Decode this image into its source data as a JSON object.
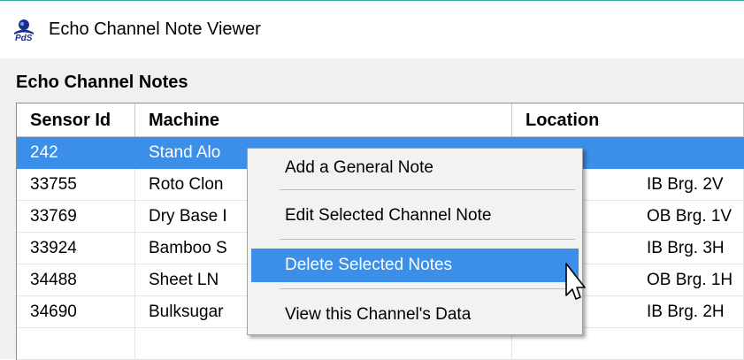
{
  "window": {
    "title": "Echo Channel Note Viewer"
  },
  "panel": {
    "title": "Echo Channel Notes"
  },
  "table": {
    "columns": [
      "Sensor Id",
      "Machine",
      "Location"
    ],
    "rows": [
      {
        "sensor_id": "242",
        "machine": "Stand Alo",
        "location": ""
      },
      {
        "sensor_id": "33755",
        "machine": "Roto Clon",
        "location": "IB Brg. 2V"
      },
      {
        "sensor_id": "33769",
        "machine": "Dry Base I",
        "location": "OB Brg. 1V"
      },
      {
        "sensor_id": "33924",
        "machine": "Bamboo S",
        "location": "IB Brg. 3H"
      },
      {
        "sensor_id": "34488",
        "machine": "Sheet LN",
        "location": "OB Brg. 1H"
      },
      {
        "sensor_id": "34690",
        "machine": "Bulksugar",
        "location": "IB Brg. 2H"
      }
    ],
    "selected_row": 0
  },
  "context_menu": {
    "items": [
      "Add a General Note",
      "Edit Selected Channel Note",
      "Delete Selected Notes",
      "View this Channel's Data"
    ],
    "highlighted_index": 2
  },
  "colors": {
    "selection": "#3b8fe8",
    "title_border": "#2aa7a0"
  },
  "icons": {
    "app": "app-logo-icon",
    "cursor": "mouse-pointer-icon"
  }
}
